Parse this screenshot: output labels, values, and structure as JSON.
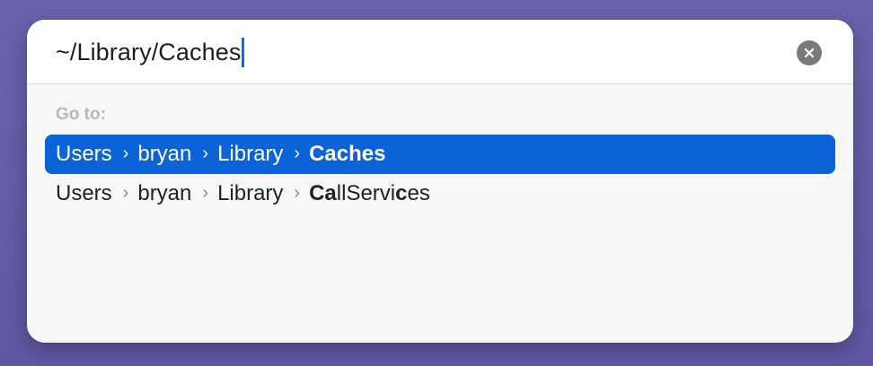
{
  "search": {
    "path_value": "~/Library/Caches"
  },
  "goto_label": "Go to:",
  "results": [
    {
      "crumbs": [
        "Users",
        "bryan",
        "Library"
      ],
      "target": "Caches",
      "selected": true
    },
    {
      "crumbs": [
        "Users",
        "bryan",
        "Library"
      ],
      "target_parts": [
        "Ca",
        "llServi",
        "c",
        "es"
      ],
      "selected": false
    }
  ],
  "icons": {
    "clear": "clear-circle-icon",
    "separator": "chevron-right-icon"
  },
  "colors": {
    "selection": "#0a64d8",
    "caret": "#0a6cf0",
    "background": "#6a62ad"
  }
}
